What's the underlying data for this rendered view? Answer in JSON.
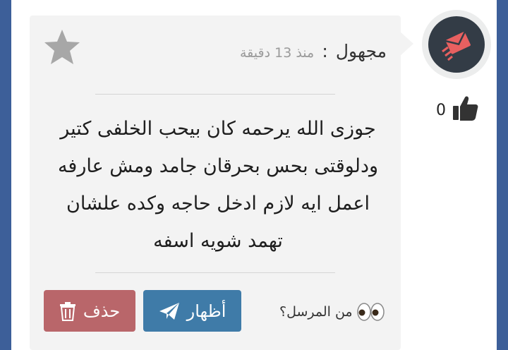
{
  "comment": {
    "author": "مجهول",
    "separator": ":",
    "time": "منذ 13 دقيقة",
    "message": "جوزى الله يرحمه كان بيحب الخلفى كتير ودلوقتى بحس بحرقان جامد ومش عارفه اعمل ايه لازم ادخل حاجه وكده علشان تهمد شويه اسفه",
    "likes": "0"
  },
  "actions": {
    "delete_label": "حذف",
    "show_label": "أظهار",
    "sender_question": "من المرسل؟"
  },
  "icons": {
    "avatar": "envelope-speed-icon",
    "like": "thumbs-up-icon",
    "favorite": "star-icon",
    "delete": "trash-icon",
    "show": "paper-plane-icon",
    "sender": "eyes-icon"
  },
  "colors": {
    "background": "#3d5f99",
    "card": "#f3f3f3",
    "avatar_bg": "#333c46",
    "avatar_accent": "#e86060",
    "delete_button": "#b9666a",
    "show_button": "#3f7ba8"
  }
}
